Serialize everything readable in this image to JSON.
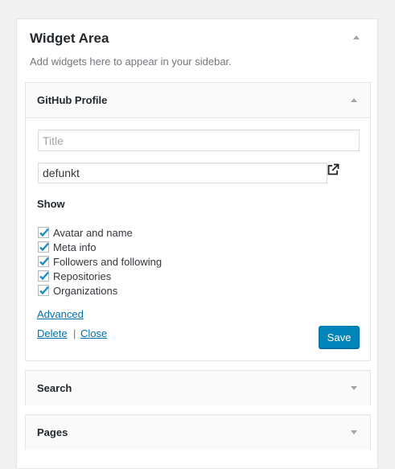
{
  "sidebar": {
    "title": "Widget Area",
    "description": "Add widgets here to appear in your sidebar."
  },
  "github_widget": {
    "title": "GitHub Profile",
    "title_field": {
      "value": "",
      "placeholder": "Title"
    },
    "username_field": {
      "value": "defunkt"
    },
    "show_label": "Show",
    "options": [
      {
        "label": "Avatar and name",
        "checked": true
      },
      {
        "label": "Meta info",
        "checked": true
      },
      {
        "label": "Followers and following",
        "checked": true
      },
      {
        "label": "Repositories",
        "checked": true
      },
      {
        "label": "Organizations",
        "checked": true
      }
    ],
    "advanced_link": "Advanced",
    "delete_link": "Delete",
    "separator": "|",
    "close_link": "Close",
    "save_label": "Save"
  },
  "collapsed_widgets": [
    {
      "title": "Search"
    },
    {
      "title": "Pages"
    }
  ],
  "colors": {
    "accent": "#0085ba",
    "link": "#0073aa",
    "checkmark": "#1e8cbe"
  }
}
